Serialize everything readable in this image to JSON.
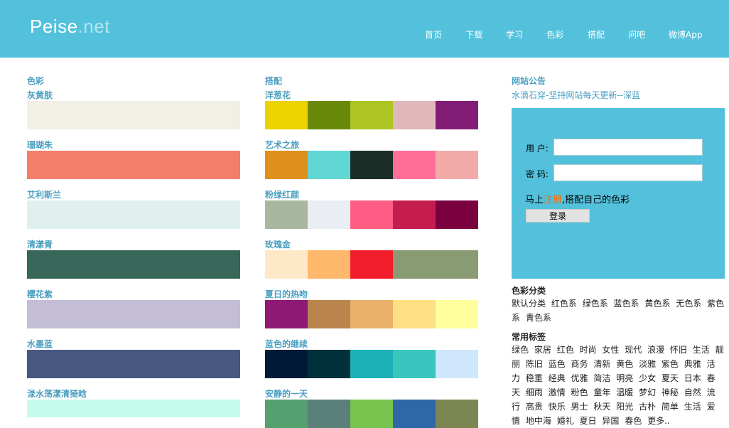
{
  "header": {
    "logo_main": "Peise",
    "logo_tld": ".net",
    "nav": [
      "首页",
      "下载",
      "学习",
      "色彩",
      "搭配",
      "问吧",
      "微博App"
    ]
  },
  "colors_section": {
    "title": "色彩",
    "items": [
      {
        "name": "灰黄肤",
        "color": "#f2efe7"
      },
      {
        "name": "珊瑚朱",
        "color": "#f37e69"
      },
      {
        "name": "艾利斯兰",
        "color": "#dff0ee"
      },
      {
        "name": "清漾青",
        "color": "#366758"
      },
      {
        "name": "樱花紫",
        "color": "#c3bed6"
      },
      {
        "name": "水墨蓝",
        "color": "#48597f"
      },
      {
        "name": "渌水荡漾清猗晗",
        "color": "#c5fbea"
      }
    ]
  },
  "schemes_section": {
    "title": "搭配",
    "items": [
      {
        "name": "洋葱花",
        "colors": [
          "#ecd300",
          "#698a08",
          "#adc525",
          "#e0b8b9",
          "#821c76"
        ]
      },
      {
        "name": "艺术之旅",
        "colors": [
          "#dd911b",
          "#60d6d3",
          "#1b2d27",
          "#ff6e98",
          "#f2aaa8"
        ]
      },
      {
        "name": "粉绿红颜",
        "colors": [
          "#aab7a0",
          "#eaedf4",
          "#ff5c83",
          "#c51d4d",
          "#7b0040"
        ]
      },
      {
        "name": "玫瑰金",
        "colors": [
          "#ffe8c7",
          "#ffb86c",
          "#f21d2b",
          "#889b73",
          "#889b73"
        ]
      },
      {
        "name": "夏日的热吻",
        "colors": [
          "#8e1a75",
          "#b9854d",
          "#e9b169",
          "#fee084",
          "#ffff9d"
        ]
      },
      {
        "name": "蓝色的继续",
        "colors": [
          "#001a38",
          "#01303d",
          "#1db1b8",
          "#3ac6be",
          "#cfe7fc"
        ]
      },
      {
        "name": "安静的一天",
        "colors": [
          "#569f6e",
          "#5b7f79",
          "#76c34d",
          "#2f68a8",
          "#7b8752"
        ]
      }
    ]
  },
  "notice": {
    "title": "网站公告",
    "text": "水滴石穿-坚持网站每天更新--深蓝"
  },
  "login": {
    "user_label": "用 户:",
    "pass_label": "密 码:",
    "reg_prefix": "马上",
    "reg_link": "注册",
    "reg_suffix": ",搭配自己的色彩",
    "button": "登录"
  },
  "categories": {
    "title": "色彩分类",
    "items": [
      "默认分类",
      "红色系",
      "绿色系",
      "蓝色系",
      "黄色系",
      "无色系",
      "紫色系",
      "青色系"
    ]
  },
  "tags": {
    "title": "常用标签",
    "items": [
      "绿色",
      "家居",
      "红色",
      "时尚",
      "女性",
      "现代",
      "浪漫",
      "怀旧",
      "生活",
      "靓丽",
      "陈旧",
      "蓝色",
      "商务",
      "清新",
      "黄色",
      "淡雅",
      "紫色",
      "典雅",
      "活力",
      "稳重",
      "经典",
      "优雅",
      "简洁",
      "明亮",
      "少女",
      "夏天",
      "日本",
      "春天",
      "细雨",
      "激情",
      "粉色",
      "童年",
      "温暖",
      "梦幻",
      "神秘",
      "自然",
      "流行",
      "高贵",
      "快乐",
      "男士",
      "秋天",
      "阳光",
      "古朴",
      "简单",
      "生活",
      "爱情",
      "地中海",
      "婚礼",
      "夏日",
      "异国",
      "春色",
      "更多.."
    ]
  }
}
